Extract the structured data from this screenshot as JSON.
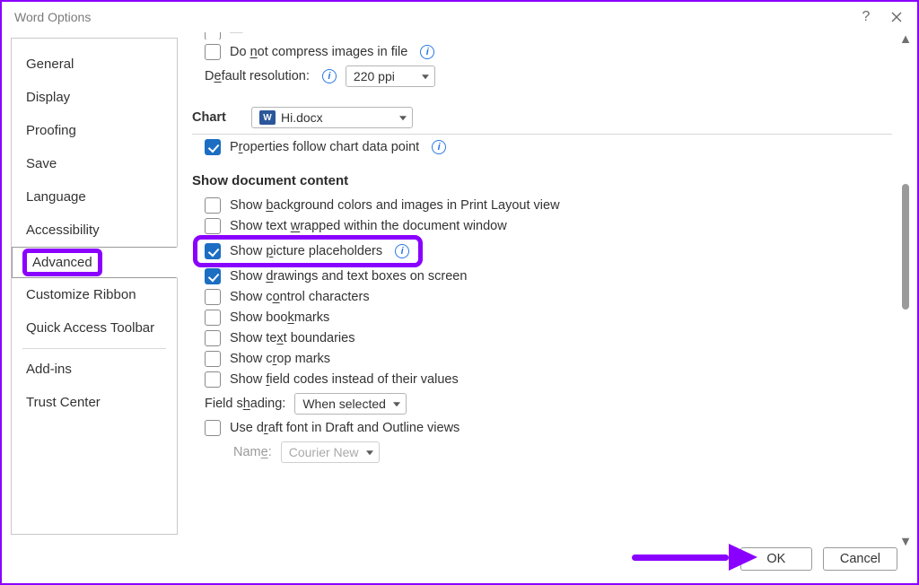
{
  "title": "Word Options",
  "sidebar": {
    "items": [
      {
        "label": "General"
      },
      {
        "label": "Display"
      },
      {
        "label": "Proofing"
      },
      {
        "label": "Save"
      },
      {
        "label": "Language"
      },
      {
        "label": "Accessibility"
      },
      {
        "label": "Advanced",
        "selected": true
      },
      {
        "label": "Customize Ribbon"
      },
      {
        "label": "Quick Access Toolbar"
      },
      {
        "label": "Add-ins"
      },
      {
        "label": "Trust Center"
      }
    ]
  },
  "top": {
    "compress_label_pre": "Do ",
    "compress_label_u": "n",
    "compress_label_post": "ot compress images in file",
    "default_res_pre": "D",
    "default_res_u": "e",
    "default_res_post": "fault resolution:",
    "default_res_value": "220 ppi"
  },
  "chart": {
    "title": "Chart",
    "file": "Hi.docx",
    "prop_pre": "P",
    "prop_u": "r",
    "prop_post": "operties follow chart data point"
  },
  "doc": {
    "title": "Show document content",
    "items": [
      {
        "pre": "Show ",
        "u": "b",
        "post": "ackground colors and images in Print Layout view",
        "checked": false
      },
      {
        "pre": "Show text ",
        "u": "w",
        "post": "rapped within the document window",
        "checked": false
      },
      {
        "pre": "Show ",
        "u": "p",
        "post": "icture placeholders",
        "checked": true,
        "info": true,
        "highlighted": true
      },
      {
        "pre": "Show ",
        "u": "d",
        "post": "rawings and text boxes on screen",
        "checked": true
      },
      {
        "pre": "Show c",
        "u": "o",
        "post": "ntrol characters",
        "checked": false
      },
      {
        "pre": "Show boo",
        "u": "k",
        "post": "marks",
        "checked": false
      },
      {
        "pre": "Show te",
        "u": "x",
        "post": "t boundaries",
        "checked": false
      },
      {
        "pre": "Show c",
        "u": "r",
        "post": "op marks",
        "checked": false
      },
      {
        "pre": "Show ",
        "u": "f",
        "post": "ield codes instead of their values",
        "checked": false
      }
    ],
    "field_shading_pre": "Field s",
    "field_shading_u": "h",
    "field_shading_post": "ading:",
    "field_shading_value": "When selected",
    "draft_pre": "Use d",
    "draft_u": "r",
    "draft_post": "aft font in Draft and Outline views",
    "name_label_pre": "Nam",
    "name_label_u": "e",
    "name_label_post": ":",
    "name_value": "Courier New"
  },
  "footer": {
    "ok": "OK",
    "cancel": "Cancel"
  }
}
